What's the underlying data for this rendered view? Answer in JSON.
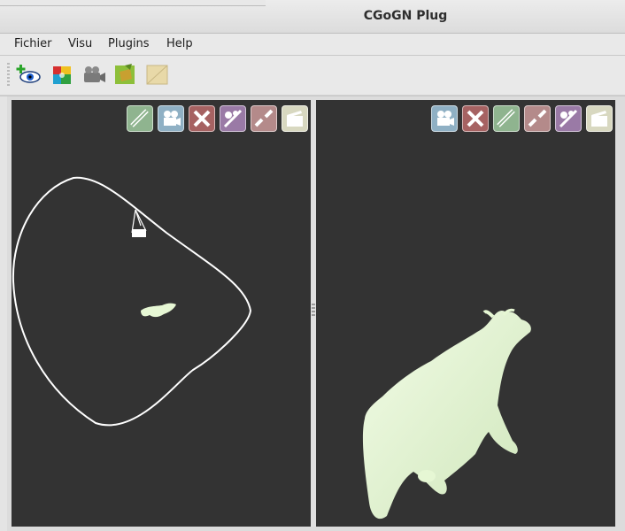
{
  "window": {
    "title": "CGoGN Plug"
  },
  "menu": {
    "items": [
      "Fichier",
      "Visu",
      "Plugins",
      "Help"
    ]
  },
  "toolbar": {
    "buttons": [
      "eye-add-icon",
      "puzzle-plugin-icon",
      "camera-icon",
      "map-load-icon",
      "map-frame-icon"
    ]
  },
  "views": {
    "left": {
      "buttons": [
        "link-icon",
        "camera-icon",
        "close-icon",
        "plugin-link-icon",
        "unlink-icon",
        "clapper-icon"
      ]
    },
    "right": {
      "buttons": [
        "camera-icon",
        "close-icon",
        "link-icon",
        "unlink-icon",
        "plugin-link-icon",
        "clapper-icon"
      ]
    }
  },
  "colors": {
    "viewport_bg": "#333333",
    "mesh_color": "#e6f7d4",
    "btn_green": "#8fb48f",
    "btn_blue": "#8fb0c4",
    "btn_red": "#a66262",
    "btn_purple": "#9a7aa6",
    "btn_pink": "#b48a8a",
    "btn_cream": "#d8d8c0"
  }
}
